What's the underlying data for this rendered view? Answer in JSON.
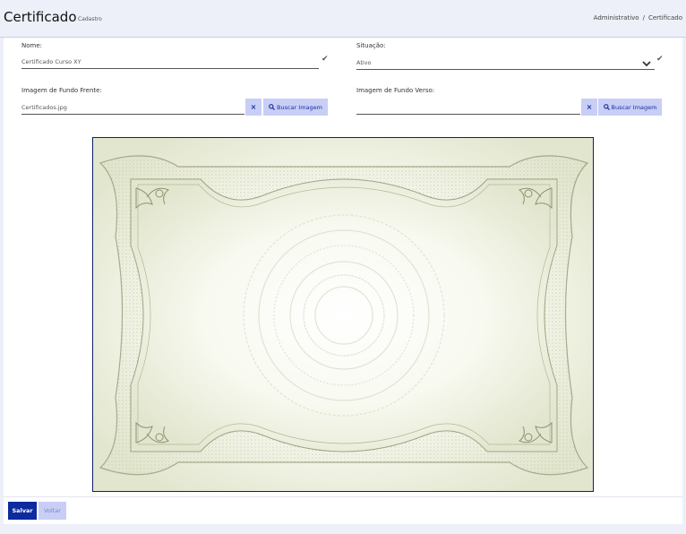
{
  "header": {
    "title": "Certificado",
    "subtitle": "Cadastro",
    "breadcrumb": [
      "Administrativo",
      "Certificado"
    ],
    "breadcrumb_separator": "/"
  },
  "form": {
    "nome": {
      "label": "Nome:",
      "value": "Certificado Curso XY"
    },
    "situacao": {
      "label": "Situação:",
      "value": "Ativo"
    },
    "frente": {
      "label": "Imagem de Fundo Frente:",
      "value": "Certificados.jpg",
      "clear_label": "×",
      "search_label": "Buscar Imagem"
    },
    "verso": {
      "label": "Imagem de Fundo Verso:",
      "value": "",
      "clear_label": "×",
      "search_label": "Buscar Imagem"
    }
  },
  "icons": {
    "check": "✔",
    "clear": "×",
    "search": "search-icon",
    "chevron": "chevron-down-icon"
  },
  "preview": {
    "kind": "certificate-background",
    "border_color": "#0d1f6e",
    "ornament_color": "#9fa484"
  },
  "footer": {
    "save_label": "Salvar",
    "back_label": "Voltar"
  },
  "colors": {
    "primary": "#0d2a9e",
    "light_button": "#c8cef5",
    "page_background": "#eef0f9"
  }
}
